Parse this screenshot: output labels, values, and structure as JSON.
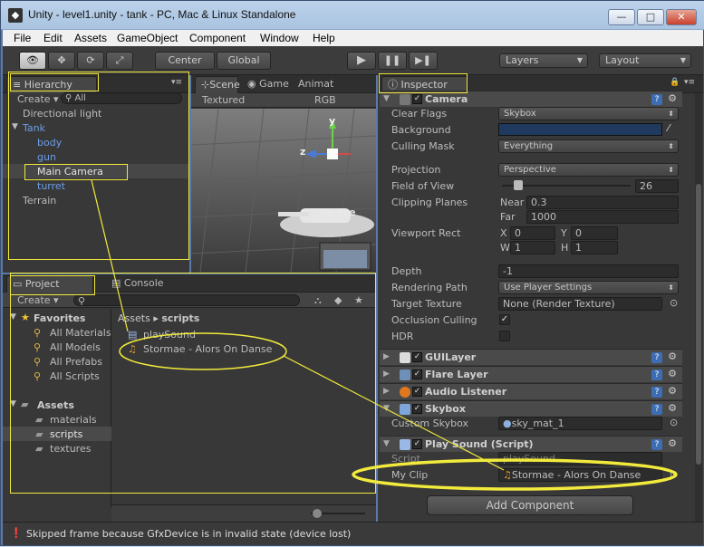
{
  "window": {
    "title": "Unity - level1.unity - tank - PC, Mac & Linux Standalone",
    "minimize": "—",
    "maximize": "□",
    "close": "✕"
  },
  "menu": [
    "File",
    "Edit",
    "Assets",
    "GameObject",
    "Component",
    "Window",
    "Help"
  ],
  "toolbar": {
    "center": "Center",
    "global": "Global",
    "layers": "Layers",
    "layout": "Layout"
  },
  "hierarchy": {
    "tab": "Hierarchy",
    "create": "Create",
    "search_placeholder": "All",
    "items": [
      "Directional light",
      "Tank",
      "body",
      "gun",
      "Main Camera",
      "turret",
      "Terrain"
    ]
  },
  "scene": {
    "tab_scene": "Scene",
    "tab_game": "Game",
    "tab_anim": "Animat",
    "render_mode": "Textured",
    "color_mode": "RGB",
    "axis_y": "y",
    "axis_z": "z",
    "preview_label": "ra Pre"
  },
  "project": {
    "tab": "Project",
    "console_tab": "Console",
    "create": "Create",
    "favorites": "Favorites",
    "fav_items": [
      "All Materials",
      "All Models",
      "All Prefabs",
      "All Scripts"
    ],
    "assets": "Assets",
    "asset_folders": [
      "materials",
      "scripts",
      "textures"
    ],
    "breadcrumb_root": "Assets",
    "breadcrumb_sep": "▸",
    "breadcrumb_leaf": "scripts",
    "files": [
      "playSound",
      "Stormae - Alors On Danse"
    ]
  },
  "inspector": {
    "tab": "Inspector",
    "camera": {
      "name": "Camera",
      "clear_flags_label": "Clear Flags",
      "clear_flags": "Skybox",
      "background_label": "Background",
      "culling_mask_label": "Culling Mask",
      "culling_mask": "Everything",
      "projection_label": "Projection",
      "projection": "Perspective",
      "fov_label": "Field of View",
      "fov": "26",
      "clipping_label": "Clipping Planes",
      "near_label": "Near",
      "near": "0.3",
      "far_label": "Far",
      "far": "1000",
      "viewport_label": "Viewport Rect",
      "x_label": "X",
      "x": "0",
      "y_label": "Y",
      "y": "0",
      "w_label": "W",
      "w": "1",
      "h_label": "H",
      "h": "1",
      "depth_label": "Depth",
      "depth": "-1",
      "rendering_path_label": "Rendering Path",
      "rendering_path": "Use Player Settings",
      "target_texture_label": "Target Texture",
      "target_texture": "None (Render Texture)",
      "occlusion_label": "Occlusion Culling",
      "hdr_label": "HDR"
    },
    "guilayer": "GUILayer",
    "flarelayer": "Flare Layer",
    "audio_listener": "Audio Listener",
    "skybox": {
      "name": "Skybox",
      "custom_label": "Custom Skybox",
      "custom_value": "sky_mat_1"
    },
    "play_sound": {
      "name": "Play Sound (Script)",
      "script_label": "Script",
      "script_value": "playSound",
      "myclip_label": "My Clip",
      "myclip_value": "Stormae - Alors On Danse"
    },
    "add_component": "Add Component"
  },
  "status": {
    "message": "Skipped frame because GfxDevice is in invalid state (device lost)"
  },
  "colors": {
    "annotation": "#f2ea3c",
    "background_swatch": "#1f3a5e"
  }
}
